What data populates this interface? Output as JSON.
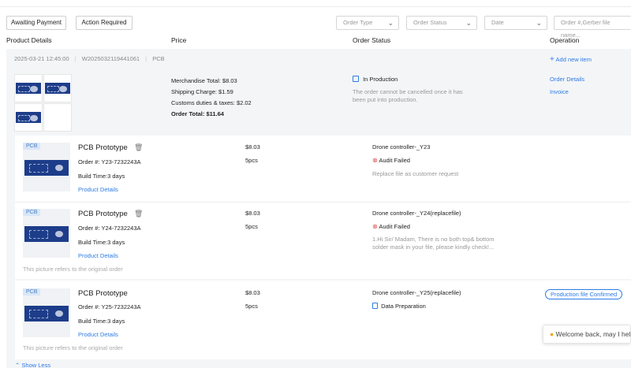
{
  "filters": {
    "tab_awaiting": "Awaiting Payment",
    "tab_action": "Action Required",
    "order_type": "Order Type",
    "order_status": "Order Status",
    "date": "Date",
    "search_placeholder": "Order #,Gerber file name..."
  },
  "columns": [
    "Product Details",
    "Price",
    "Order Status",
    "Operation"
  ],
  "order": {
    "datetime": "2025-03-21 12:45:00",
    "number": "W2025032119441061",
    "category": "PCB",
    "add_item": "Add new item",
    "merchandise_total": "Merchandise Total: $8.03",
    "shipping": "Shipping Charge: $1.59",
    "customs": "Customs duties & taxes: $2.02",
    "order_total": "Order Total: $11.64",
    "status": "In Production",
    "status_note": "The order cannot be cancelled once it has been put into production.",
    "op_details": "Order Details",
    "op_invoice": "Invoice"
  },
  "items": [
    {
      "tag": "PCB",
      "title": "PCB Prototype",
      "order_no": "Order #: Y23-7232243A",
      "build_time": "Build Time:3 days",
      "details_link": "Product Details",
      "price": "$8.03",
      "qty": "5pcs",
      "file": "Drone controller-_Y23",
      "status": "Audit Failed",
      "note": "Replace file as customer request",
      "picture_note": "",
      "action": ""
    },
    {
      "tag": "PCB",
      "title": "PCB Prototype",
      "order_no": "Order #: Y24-7232243A",
      "build_time": "Build Time:3 days",
      "details_link": "Product Details",
      "price": "$8.03",
      "qty": "5pcs",
      "file": "Drone controller-_Y24(replacefile)",
      "status": "Audit Failed",
      "note": "1.Hi Sir/ Madam, There is no both top& bottom solder mask in your file, please kindly check!...",
      "picture_note": "This picture refers to the original order",
      "action": ""
    },
    {
      "tag": "PCB",
      "title": "PCB Prototype",
      "order_no": "Order #: Y25-7232243A",
      "build_time": "Build Time:3 days",
      "details_link": "Product Details",
      "price": "$8.03",
      "qty": "5pcs",
      "file": "Drone controller-_Y25(replacefile)",
      "status": "Data Preparation",
      "note": "",
      "picture_note": "This picture refers to the original order",
      "action": "Production file Confirmed"
    }
  ],
  "show_less": "Show Less",
  "chat": "Welcome back, may I help"
}
